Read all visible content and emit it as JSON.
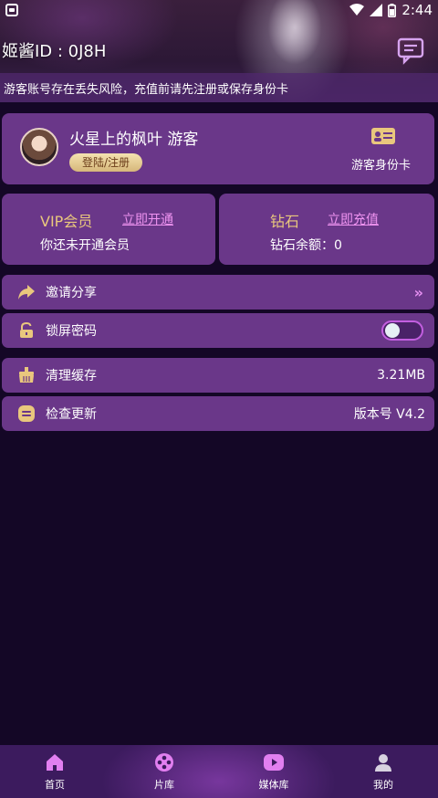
{
  "status_bar": {
    "time": "2:44"
  },
  "header": {
    "user_id": "姬酱ID : 0J8H",
    "notice": "游客账号存在丢失风险，充值前请先注册或保存身份卡"
  },
  "profile": {
    "nickname": "火星上的枫叶 游客",
    "login_label": "登陆/注册",
    "id_card_label": "游客身份卡"
  },
  "vip": {
    "title": "VIP会员",
    "action": "立即开通",
    "status": "你还未开通会员"
  },
  "diamond": {
    "title": "钻石",
    "action": "立即充值",
    "balance_label": "钻石余额：",
    "balance_value": "0"
  },
  "menu": {
    "invite_label": "邀请分享",
    "lock_label": "锁屏密码",
    "lock_enabled": false,
    "cache_label": "清理缓存",
    "cache_value": "3.21MB",
    "update_label": "检查更新",
    "version_value": "版本号 V4.2"
  },
  "tabs": [
    {
      "label": "首页",
      "icon": "home-icon"
    },
    {
      "label": "片库",
      "icon": "film-reel-icon"
    },
    {
      "label": "媒体库",
      "icon": "play-icon"
    },
    {
      "label": "我的",
      "icon": "person-icon"
    }
  ],
  "colors": {
    "background": "#140726",
    "card": "#6a3789",
    "gold": "#e9c77d",
    "link": "#ee93f0",
    "accent_pink": "#e48ef0"
  }
}
